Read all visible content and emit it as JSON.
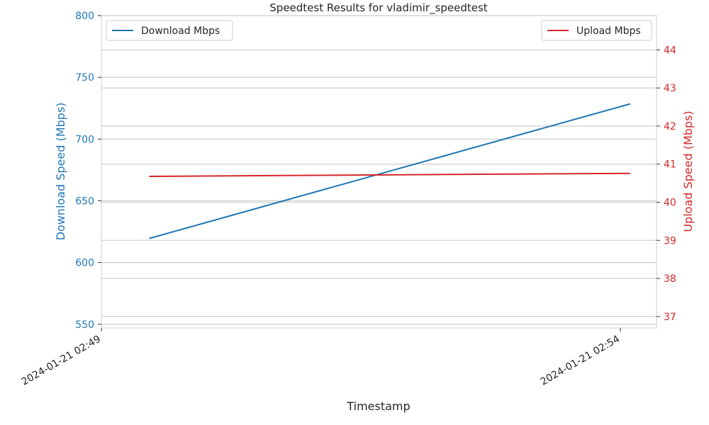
{
  "chart_data": {
    "type": "line",
    "title": "Speedtest Results for vladimir_speedtest",
    "xlabel": "Timestamp",
    "x_ticks": [
      "2024-01-21 02:49",
      "2024-01-21 02:54"
    ],
    "x_range": [
      "2024-01-21 02:49",
      "2024-01-21 02:54"
    ],
    "left_axis": {
      "label": "Download Speed (Mbps)",
      "color": "#1f77b4",
      "ylim": [
        547,
        800
      ],
      "ticks": [
        550,
        600,
        650,
        700,
        750,
        800
      ]
    },
    "right_axis": {
      "label": "Upload Speed (Mbps)",
      "color": "#d62728",
      "ylim": [
        36.7,
        44.9
      ],
      "ticks": [
        37,
        38,
        39,
        40,
        41,
        42,
        43,
        44
      ]
    },
    "series": [
      {
        "name": "Download Mbps",
        "axis": "left",
        "color": "#1f77b4",
        "points": [
          {
            "x": "2024-01-21 02:49:17",
            "y": 619.5
          },
          {
            "x": "2024-01-21 02:53:55",
            "y": 728.5
          }
        ]
      },
      {
        "name": "Upload Mbps",
        "axis": "right",
        "color": "#d62728",
        "points": [
          {
            "x": "2024-01-21 02:49:17",
            "y": 40.68
          },
          {
            "x": "2024-01-21 02:53:55",
            "y": 40.76
          }
        ]
      }
    ],
    "legends": [
      {
        "placement": "top-left",
        "series": "Download Mbps"
      },
      {
        "placement": "top-right",
        "series": "Upload Mbps"
      }
    ],
    "grid": true
  }
}
